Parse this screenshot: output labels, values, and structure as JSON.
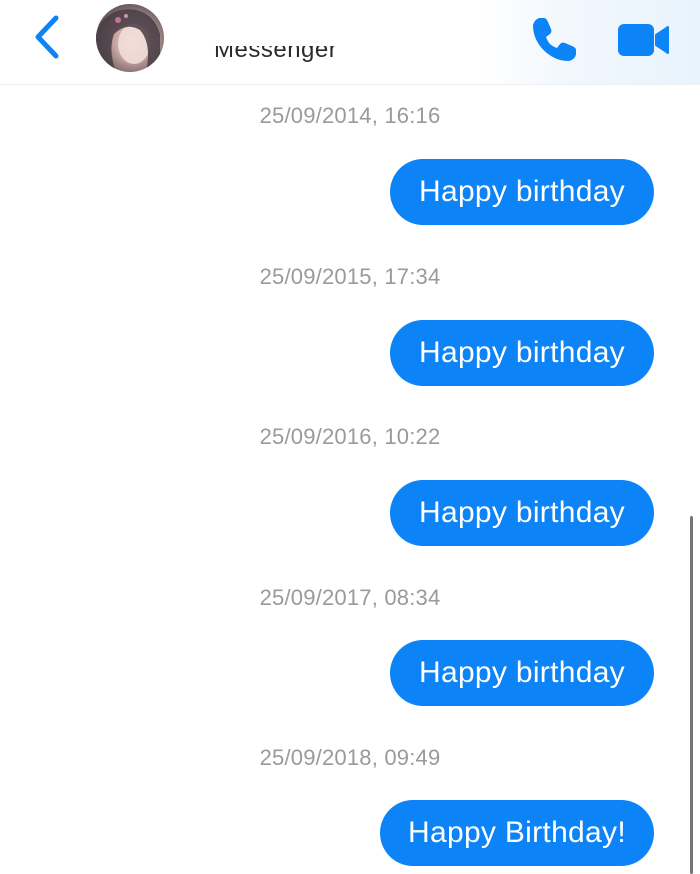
{
  "header": {
    "subtitle": "Messenger",
    "colors": {
      "accent": "#0c83f6"
    },
    "icons": {
      "back": "chevron-left-icon",
      "call": "phone-icon",
      "video": "video-camera-icon"
    }
  },
  "messages": [
    {
      "timestamp": "25/09/2014, 16:16",
      "text": "Happy birthday"
    },
    {
      "timestamp": "25/09/2015, 17:34",
      "text": "Happy birthday"
    },
    {
      "timestamp": "25/09/2016, 10:22",
      "text": "Happy birthday"
    },
    {
      "timestamp": "25/09/2017, 08:34",
      "text": "Happy birthday"
    },
    {
      "timestamp": "25/09/2018, 09:49",
      "text": "Happy Birthday!"
    }
  ]
}
